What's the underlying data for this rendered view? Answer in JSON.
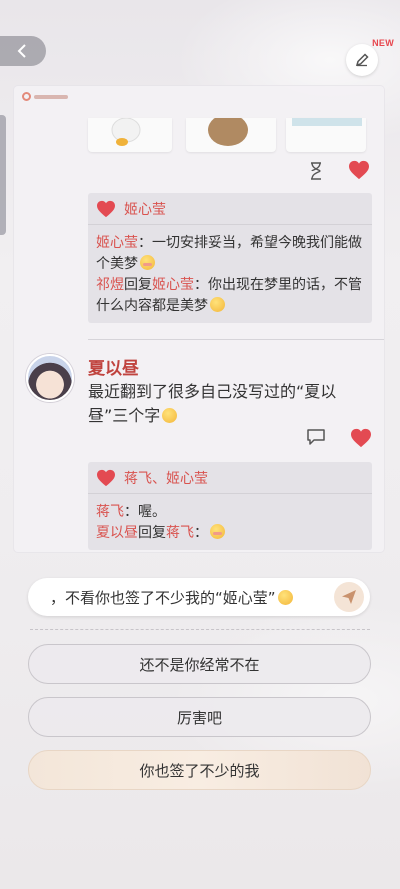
{
  "header": {
    "new_badge": "NEW"
  },
  "feed": {
    "first_comments": {
      "likers": "姬心莹",
      "lines": [
        {
          "name": "姬心莹",
          "sep": "：",
          "text": "一切安排妥当，希望今晚我们能做个美梦"
        },
        {
          "name": "祁煜",
          "mid": "回复",
          "target": "姬心莹",
          "sep": "：",
          "text": "你出现在梦里的话，不管什么内容都是美梦"
        }
      ]
    },
    "post": {
      "author": "夏以昼",
      "text": "最近翻到了很多自己没写过的“夏以昼”三个字",
      "comments": {
        "likers": "蒋飞、姬心莹",
        "lines": [
          {
            "name": "蒋飞",
            "sep": "：",
            "text": "喔。"
          },
          {
            "name": "夏以昼",
            "mid": "回复",
            "target": "蒋飞",
            "sep": "：",
            "text": ""
          }
        ]
      }
    }
  },
  "reply": {
    "text": "，不看你也签了不少我的“姬心莹”"
  },
  "choices": [
    {
      "label": "还不是你经常不在",
      "selected": false
    },
    {
      "label": "厉害吧",
      "selected": false
    },
    {
      "label": "你也签了不少的我",
      "selected": true
    }
  ],
  "colors": {
    "accent": "#d9534f",
    "heart": "#e34a52"
  }
}
